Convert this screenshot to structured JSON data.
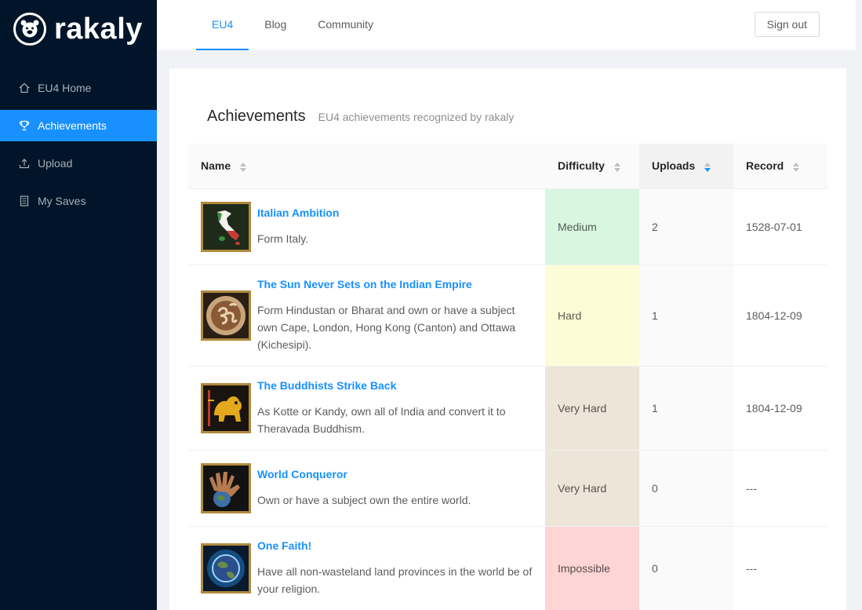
{
  "app": {
    "logo_text": "rakaly"
  },
  "sidebar": {
    "items": [
      {
        "label": "EU4 Home",
        "icon": "home-icon",
        "active": false
      },
      {
        "label": "Achievements",
        "icon": "trophy-icon",
        "active": true
      },
      {
        "label": "Upload",
        "icon": "upload-icon",
        "active": false
      },
      {
        "label": "My Saves",
        "icon": "saves-icon",
        "active": false
      }
    ]
  },
  "header": {
    "tabs": [
      {
        "label": "EU4",
        "active": true
      },
      {
        "label": "Blog",
        "active": false
      },
      {
        "label": "Community",
        "active": false
      }
    ],
    "signout_label": "Sign out"
  },
  "page": {
    "title": "Achievements",
    "subtitle": "EU4 achievements recognized by rakaly"
  },
  "table": {
    "columns": [
      "Name",
      "Difficulty",
      "Uploads",
      "Record"
    ],
    "sorted_column": "Uploads",
    "rows": [
      {
        "title": "Italian Ambition",
        "description": "Form Italy.",
        "difficulty": "Medium",
        "difficulty_color": "#d9f7e0",
        "uploads": "2",
        "record": "1528-07-01",
        "icon": "italy-map-icon"
      },
      {
        "title": "The Sun Never Sets on the Indian Empire",
        "description": "Form Hindustan or Bharat and own or have a subject own Cape, London, Hong Kong (Canton) and Ottawa (Kichesipi).",
        "difficulty": "Hard",
        "difficulty_color": "#fcfcd7",
        "uploads": "1",
        "record": "1804-12-09",
        "icon": "om-symbol-icon"
      },
      {
        "title": "The Buddhists Strike Back",
        "description": "As Kotte or Kandy, own all of India and convert it to Theravada Buddhism.",
        "difficulty": "Very Hard",
        "difficulty_color": "#ede5d8",
        "uploads": "1",
        "record": "1804-12-09",
        "icon": "lion-flag-icon"
      },
      {
        "title": "World Conqueror",
        "description": "Own or have a subject own the entire world.",
        "difficulty": "Very Hard",
        "difficulty_color": "#ede5d8",
        "uploads": "0",
        "record": "---",
        "icon": "hand-globe-icon"
      },
      {
        "title": "One Faith!",
        "description": "Have all non-wasteland land provinces in the world be of your religion.",
        "difficulty": "Impossible",
        "difficulty_color": "#fdd5d5",
        "uploads": "0",
        "record": "---",
        "icon": "glowing-earth-icon"
      }
    ]
  }
}
